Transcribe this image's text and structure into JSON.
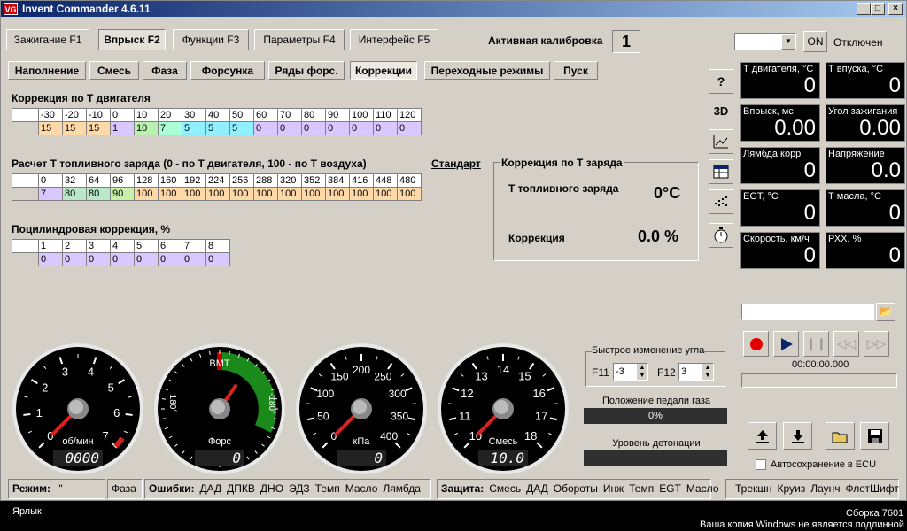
{
  "window": {
    "title": "Invent Commander 4.6.11",
    "icon_text": "VG",
    "min": "_",
    "max": "□",
    "close": "×"
  },
  "main_tabs": [
    "Зажигание F1",
    "Впрыск F2",
    "Функции F3",
    "Параметры F4",
    "Интерфейс F5"
  ],
  "active_calibration": {
    "label": "Активная калибровка",
    "value": "1"
  },
  "connection": {
    "combo_value": "",
    "on_button": "ON",
    "status": "Отключен"
  },
  "sub_tabs": [
    "Наполнение",
    "Смесь",
    "Фаза",
    "Форсунка",
    "Ряды форс.",
    "Коррекции",
    "Переходные режимы",
    "Пуск"
  ],
  "engine_temp_correction": {
    "title": "Коррекция по Т двигателя",
    "headers": [
      "-30",
      "-20",
      "-10",
      "0",
      "10",
      "20",
      "30",
      "40",
      "50",
      "60",
      "70",
      "80",
      "90",
      "100",
      "110",
      "120"
    ],
    "values": [
      "15",
      "15",
      "15",
      "1",
      "10",
      "7",
      "5",
      "5",
      "5",
      "0",
      "0",
      "0",
      "0",
      "0",
      "0",
      "0"
    ]
  },
  "fuel_charge_temp": {
    "title": "Расчет Т топливного заряда (0 - по Т двигателя, 100 - по Т воздуха)",
    "link": "Стандарт",
    "headers": [
      "0",
      "32",
      "64",
      "96",
      "128",
      "160",
      "192",
      "224",
      "256",
      "288",
      "320",
      "352",
      "384",
      "416",
      "448",
      "480"
    ],
    "values": [
      "7",
      "80",
      "80",
      "90",
      "100",
      "100",
      "100",
      "100",
      "100",
      "100",
      "100",
      "100",
      "100",
      "100",
      "100",
      "100"
    ]
  },
  "cylinder_correction": {
    "title": "Поцилиндровая коррекция, %",
    "headers": [
      "1",
      "2",
      "3",
      "4",
      "5",
      "6",
      "7",
      "8"
    ],
    "values": [
      "0",
      "0",
      "0",
      "0",
      "0",
      "0",
      "0",
      "0"
    ]
  },
  "charge_correction": {
    "title": "Коррекция по Т заряда",
    "temp_label": "Т топливного заряда",
    "temp_value": "0°C",
    "corr_label": "Коррекция",
    "corr_value": "0.0 %"
  },
  "side_buttons": [
    "?",
    "3D",
    "chart-icon",
    "table-icon",
    "dots-icon",
    "stopwatch-icon"
  ],
  "sensors": [
    {
      "label": "Т двигателя, °С",
      "value": "0"
    },
    {
      "label": "Т впуска, °С",
      "value": "0"
    },
    {
      "label": "Впрыск, мс",
      "value": "0.00"
    },
    {
      "label": "Угол зажигания",
      "value": "0.00"
    },
    {
      "label": "Лямбда корр",
      "value": "0"
    },
    {
      "label": "Напряжение",
      "value": "0.0"
    },
    {
      "label": "EGT, °С",
      "value": "0"
    },
    {
      "label": "Т масла, °С",
      "value": "0"
    },
    {
      "label": "Скорость, км/ч",
      "value": "0"
    },
    {
      "label": "РХХ, %",
      "value": "0"
    }
  ],
  "player": {
    "file_value": "",
    "time": "00:00:00.000"
  },
  "quick_angle": {
    "title": "Быстрое изменение угла",
    "f11_label": "F11",
    "f11_value": "-3",
    "f12_label": "F12",
    "f12_value": "3"
  },
  "pedal": {
    "title": "Положение педали газа",
    "value": "0%"
  },
  "detonation": {
    "title": "Уровень детонации"
  },
  "autosave": {
    "label": "Автосохранение в ECU",
    "checked": false
  },
  "gauges": {
    "rpm": {
      "ticks": [
        "0",
        "1",
        "2",
        "3",
        "4",
        "5",
        "6",
        "7"
      ],
      "unit": "об/мин",
      "digital": "0000"
    },
    "phase": {
      "top": "BMT",
      "left": "180°",
      "right": "-180°",
      "unit": "Форс",
      "digital": "0"
    },
    "map": {
      "ticks": [
        "0",
        "50",
        "100",
        "150",
        "200",
        "250",
        "300",
        "350",
        "400"
      ],
      "unit": "кПа",
      "digital": "0"
    },
    "afr": {
      "ticks": [
        "10",
        "11",
        "12",
        "13",
        "14",
        "15",
        "16",
        "17",
        "18"
      ],
      "unit": "Смесь",
      "digital": "10.0"
    }
  },
  "statusbar": {
    "mode_label": "Режим:",
    "mode_value": "\"",
    "phase": "Фаза",
    "errors_label": "Ошибки:",
    "errors": [
      "ДАД",
      "ДПКВ",
      "ДНО",
      "ЭДЗ",
      "Темп",
      "Масло",
      "Лямбда"
    ],
    "protect_label": "Защита:",
    "protect": [
      "Смесь",
      "ДАД",
      "Обороты",
      "Инж",
      "Темп",
      "EGT",
      "Масло"
    ],
    "extras": [
      "Трекшн",
      "Круиз",
      "Лаунч",
      "ФлетШифт"
    ]
  },
  "taskbar": {
    "left1": "Ярлык",
    "right1": "Сборка 7601",
    "right2": "Ваша копия Windows не является подлинной"
  },
  "colors": {
    "title_start": "#0a246a",
    "title_end": "#a6caf0",
    "needle": "#e02020",
    "green_arc": "#1a8a1a",
    "record": "#e00000"
  }
}
